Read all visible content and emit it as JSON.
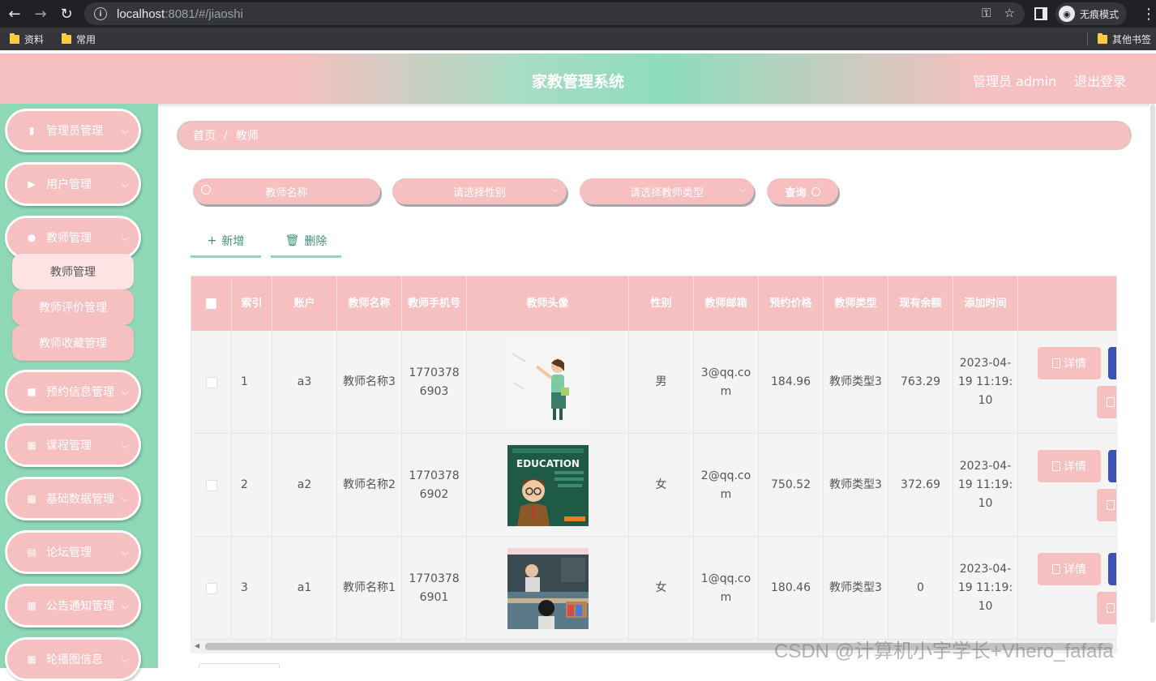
{
  "browser": {
    "url_host": "localhost",
    "url_rest": ":8081/#/jiaoshi",
    "incognito_label": "无痕模式",
    "bookmarks": [
      "资料",
      "常用"
    ],
    "other_bookmarks": "其他书签"
  },
  "header": {
    "title": "家教管理系统",
    "user": "管理员 admin",
    "logout": "退出登录"
  },
  "sidebar": {
    "items": [
      {
        "label": "管理员管理",
        "icon": "clipboard-icon"
      },
      {
        "label": "用户管理",
        "icon": "video-icon"
      },
      {
        "label": "教师管理",
        "icon": "user-icon"
      },
      {
        "label": "预约信息管理",
        "icon": "briefcase-icon"
      },
      {
        "label": "课程管理",
        "icon": "grid-icon"
      },
      {
        "label": "基础数据管理",
        "icon": "grid-icon"
      },
      {
        "label": "论坛管理",
        "icon": "chart-icon"
      },
      {
        "label": "公告通知管理",
        "icon": "grid-icon"
      },
      {
        "label": "轮播图信息",
        "icon": "grid-icon"
      }
    ],
    "submenu": [
      "教师管理",
      "教师评价管理",
      "教师收藏管理"
    ]
  },
  "breadcrumb": {
    "home": "首页",
    "sep": "/",
    "current": "教师"
  },
  "search": {
    "name_placeholder": "教师名称",
    "gender_placeholder": "请选择性别",
    "type_placeholder": "请选择教师类型",
    "query_label": "查询"
  },
  "actions": {
    "add": "新增",
    "delete": "删除"
  },
  "table": {
    "headers": [
      "索引",
      "账户",
      "教师名称",
      "教师手机号",
      "教师头像",
      "性别",
      "教师邮箱",
      "预约价格",
      "教师类型",
      "现有余额",
      "添加时间"
    ],
    "rows": [
      {
        "index": "1",
        "account": "a3",
        "name": "教师名称3",
        "phone": "17703786903",
        "gender": "男",
        "email": "3@qq.com",
        "price": "184.96",
        "type": "教师类型3",
        "balance": "763.29",
        "time": "2023-04-19 11:19:10"
      },
      {
        "index": "2",
        "account": "a2",
        "name": "教师名称2",
        "phone": "17703786902",
        "gender": "女",
        "email": "2@qq.com",
        "price": "750.52",
        "type": "教师类型3",
        "balance": "372.69",
        "time": "2023-04-19 11:19:10"
      },
      {
        "index": "3",
        "account": "a1",
        "name": "教师名称1",
        "phone": "17703786901",
        "gender": "女",
        "email": "1@qq.com",
        "price": "180.46",
        "type": "教师类型3",
        "balance": "0",
        "time": "2023-04-19 11:19:10"
      }
    ],
    "detail_label": "详情"
  },
  "watermark": "CSDN @计算机小宇学长+Vhero_fafafa",
  "colors": {
    "pink": "#f6bfc0",
    "mint": "#8ed8b8",
    "indigo": "#3f51b5"
  }
}
